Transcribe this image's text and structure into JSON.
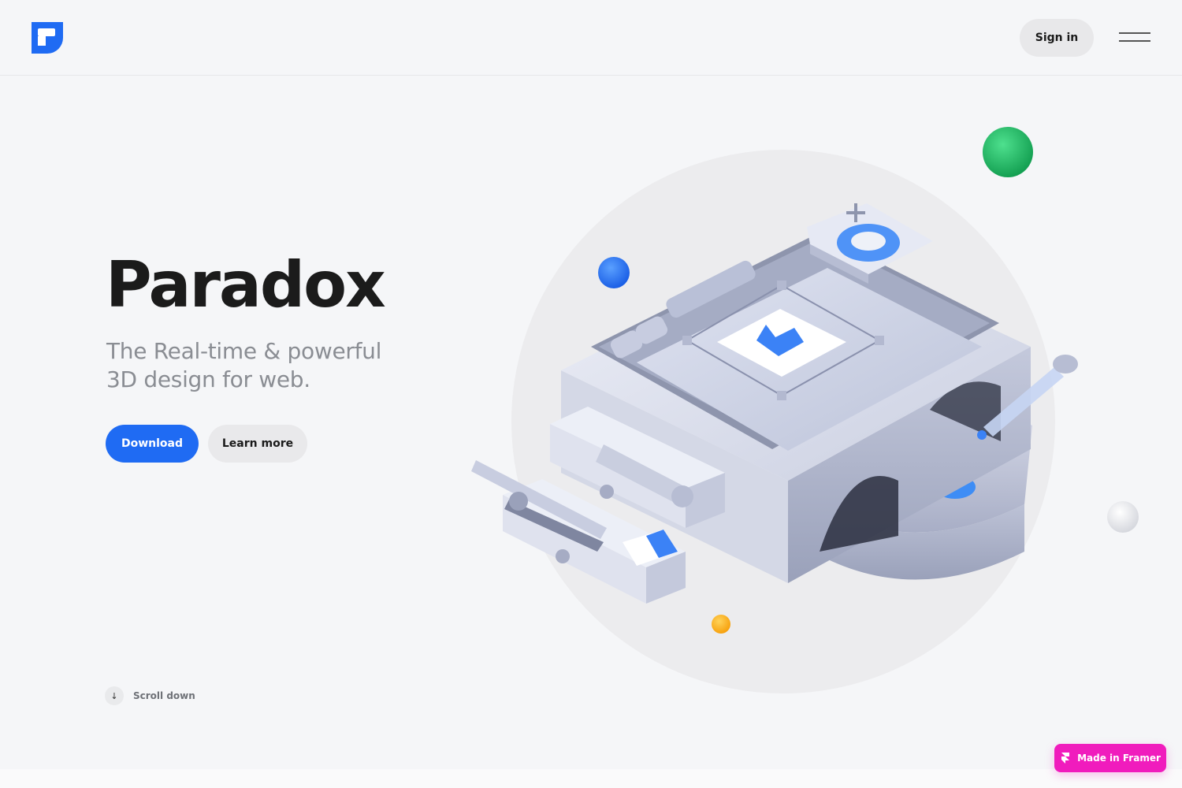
{
  "header": {
    "logo_icon": "paradox-logo-icon",
    "signin_label": "Sign in",
    "menu_icon": "hamburger-menu-icon"
  },
  "hero": {
    "title": "Paradox",
    "subtitle": "The Real-time & powerful 3D design for web.",
    "download_label": "Download",
    "learn_more_label": "Learn more",
    "scroll_label": "Scroll down",
    "scroll_icon": "arrow-down-icon"
  },
  "illustration": {
    "name": "3d-design-tool-illustration",
    "icons": [
      "image-icon",
      "plus-icon",
      "ring-icon",
      "pencil-icon",
      "ruler-icon",
      "brush-icon",
      "eraser-icon",
      "dropper-icon"
    ]
  },
  "badge": {
    "label": "Made in Framer",
    "icon": "framer-icon"
  },
  "colors": {
    "accent": "#1f6bf3",
    "badge": "#f01cbd",
    "green_sphere": "#1fb865",
    "yellow_sphere": "#fdb21a"
  }
}
